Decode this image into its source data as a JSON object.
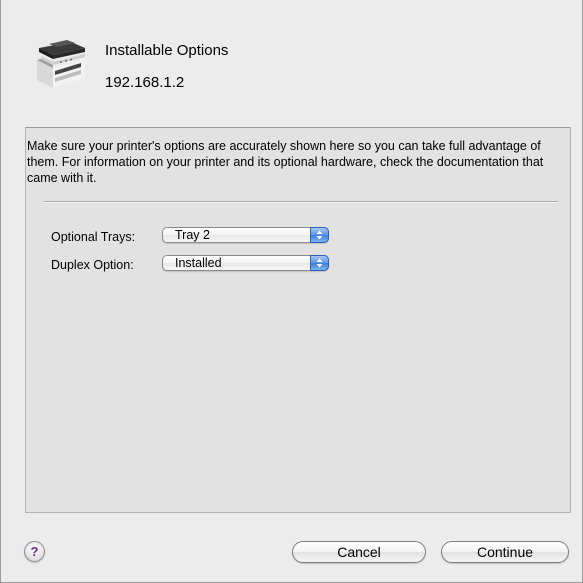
{
  "header": {
    "title": "Installable Options",
    "subtitle": "192.168.1.2",
    "icon": "printer-icon"
  },
  "panel": {
    "description": "Make sure your printer's options are accurately shown here so you can take full advantage of them.  For information on your printer and its optional hardware, check the documentation that came with it.",
    "options": [
      {
        "label": "Optional Trays:",
        "selected": "Tray 2"
      },
      {
        "label": "Duplex Option:",
        "selected": "Installed"
      }
    ]
  },
  "footer": {
    "help_label": "?",
    "cancel_label": "Cancel",
    "continue_label": "Continue"
  }
}
